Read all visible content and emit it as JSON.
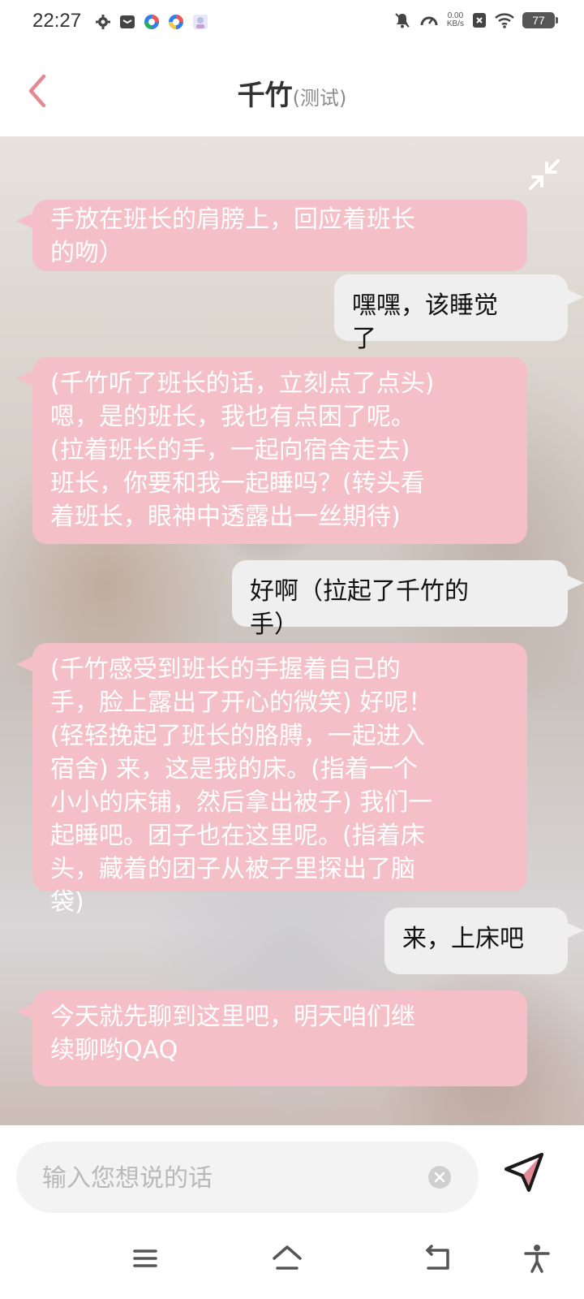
{
  "status_bar": {
    "time": "22:27",
    "net_speed": "0.00",
    "net_unit": "KB/s",
    "battery": "77",
    "left_icons": [
      "settings-icon",
      "mail-icon",
      "browser-icon",
      "browser-icon-2",
      "avatar-icon"
    ],
    "right_icons": [
      "mute-icon",
      "speed-icon",
      "sim-x-icon",
      "wifi-icon"
    ]
  },
  "header": {
    "title": "千竹",
    "subtitle": "(测试)"
  },
  "messages": [
    {
      "role": "bot",
      "text": "手放在班长的肩膀上，回应着班长\n的吻）"
    },
    {
      "role": "user",
      "text": "嘿嘿，该睡觉\n了"
    },
    {
      "role": "bot",
      "text": "(千竹听了班长的话，立刻点了点头)\n嗯，是的班长，我也有点困了呢。\n(拉着班长的手，一起向宿舍走去)\n班长，你要和我一起睡吗？(转头看\n着班长，眼神中透露出一丝期待)"
    },
    {
      "role": "user",
      "text": "好啊（拉起了千竹的\n手）"
    },
    {
      "role": "bot",
      "text": "(千竹感受到班长的手握着自己的\n手，脸上露出了开心的微笑) 好呢！\n(轻轻挽起了班长的胳膊，一起进入\n宿舍) 来，这是我的床。(指着一个\n小小的床铺，然后拿出被子) 我们一\n起睡吧。团子也在这里呢。(指着床\n头，藏着的团子从被子里探出了脑\n袋)"
    },
    {
      "role": "user",
      "text": "来，上床吧"
    },
    {
      "role": "bot",
      "text": "今天就先聊到这里吧，明天咱们继\n续聊哟QAQ"
    }
  ],
  "input": {
    "placeholder": "输入您想说的话",
    "value": ""
  },
  "colors": {
    "accent": "#e58a95",
    "bot_bubble": "#f4bfc6",
    "user_bubble": "#efefef"
  },
  "nav": [
    "menu-icon",
    "home-icon",
    "back-nav-icon",
    "accessibility-icon"
  ]
}
